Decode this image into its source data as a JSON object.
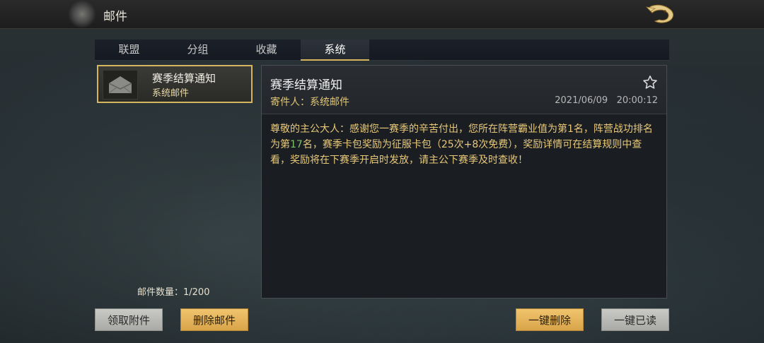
{
  "header": {
    "title": "邮件"
  },
  "tabs": [
    {
      "label": "联盟"
    },
    {
      "label": "分组"
    },
    {
      "label": "收藏"
    },
    {
      "label": "系统"
    }
  ],
  "active_tab": "系统",
  "mail_list": {
    "items": [
      {
        "title": "赛季结算通知",
        "sender": "系统邮件"
      }
    ],
    "count_text": "邮件数量：1/200"
  },
  "detail": {
    "title": "赛季结算通知",
    "sender_label": "寄件人：系统邮件",
    "date": "2021/06/09",
    "time": "20:00:12",
    "body_parts": [
      "尊敬的主公大人：感谢您一赛季的辛苦付出，您所在阵营霸业值为第1名，阵营战功排名为第",
      "17",
      "名，赛季卡包奖励为征服卡包（25次+8次免费），奖励详情可在结算规则中查看，奖励将在下赛季开启时发放，请主公下赛季及时查收！"
    ]
  },
  "buttons": {
    "claim_attachments": "领取附件",
    "delete_mail": "删除邮件",
    "delete_all": "一键删除",
    "mark_all_read": "一键已读"
  },
  "colors": {
    "accent_gold": "#d6b560",
    "highlight_green": "#7ec26a",
    "body_text": "#e8c979"
  },
  "icons": {
    "mail_item": "open-envelope-icon",
    "favorite": "star-outline-icon",
    "logo": "dragon-logo-icon"
  }
}
